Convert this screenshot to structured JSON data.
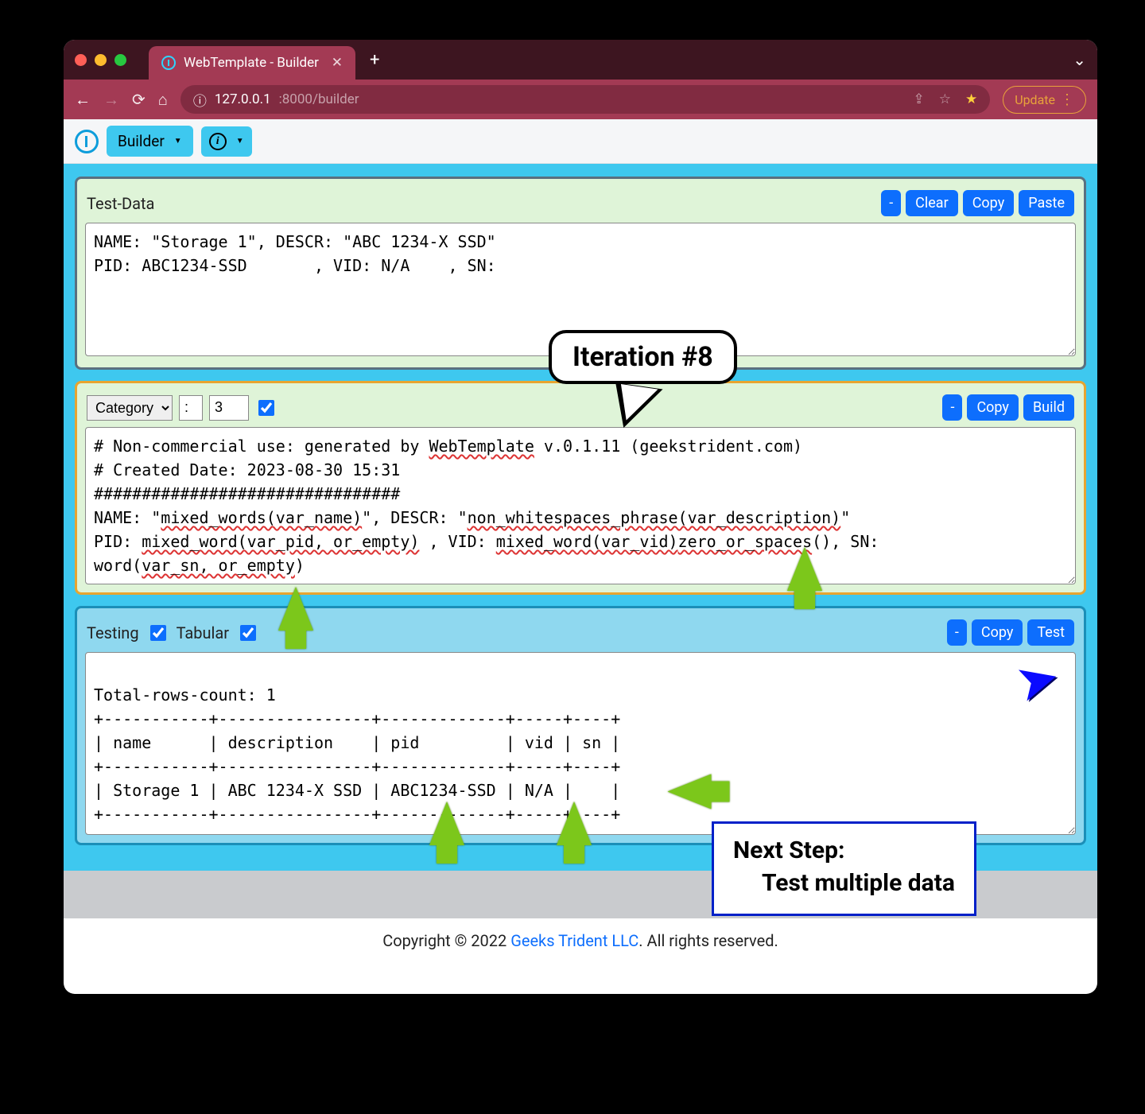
{
  "browser": {
    "tab_title": "WebTemplate - Builder",
    "url_prefix": "127.0.0.1",
    "url_suffix": ":8000/builder",
    "update_label": "Update"
  },
  "toolbar": {
    "builder_label": "Builder"
  },
  "panel_testdata": {
    "title": "Test-Data",
    "buttons": {
      "minus": "-",
      "clear": "Clear",
      "copy": "Copy",
      "paste": "Paste"
    },
    "content": "NAME: \"Storage 1\", DESCR: \"ABC 1234-X SSD\"\nPID: ABC1234-SSD       , VID: N/A    , SN:"
  },
  "panel_template": {
    "select_value": "Category",
    "colon_value": ":",
    "num_value": "3",
    "checkbox": true,
    "buttons": {
      "minus": "-",
      "copy": "Copy",
      "build": "Build"
    },
    "lines": {
      "l1a": "# Non-commercial use: generated by ",
      "l1b": "WebTemplate",
      "l1c": " v.0.1.11 (geekstrident.com)",
      "l2": "# Created Date: 2023-08-30 15:31",
      "l3": "################################",
      "l4a": "NAME: \"",
      "l4b": "mixed_words(var_name)",
      "l4c": "\", DESCR: \"",
      "l4d": "non_whitespaces_phrase(var_description)",
      "l4e": "\"",
      "l5a": "PID: ",
      "l5b": "mixed_word(var_pid, or_empty)",
      "l5c": "  ,  VID: ",
      "l5d": "mixed_word(var_vid)",
      "l5e": "zero_or_spaces",
      "l5f": "(),  SN: ",
      "l6a": "word(",
      "l6b": "var_sn, or_empty",
      "l6c": ")"
    }
  },
  "panel_testing": {
    "title": "Testing",
    "tabular_label": "Tabular",
    "testing_checked": true,
    "tabular_checked": true,
    "buttons": {
      "minus": "-",
      "copy": "Copy",
      "test": "Test"
    },
    "content": "\nTotal-rows-count: 1\n+-----------+----------------+-------------+-----+----+\n| name      | description    | pid         | vid | sn |\n+-----------+----------------+-------------+-----+----+\n| Storage 1 | ABC 1234-X SSD | ABC1234-SSD | N/A |    |\n+-----------+----------------+-------------+-----+----+\n"
  },
  "footer": {
    "pre": "Copyright © 2022 ",
    "link": "Geeks Trident LLC",
    "post": ". All rights reserved."
  },
  "overlays": {
    "bubble": "Iteration #8",
    "next_title": "Next Step:",
    "next_body": "Test multiple data"
  }
}
